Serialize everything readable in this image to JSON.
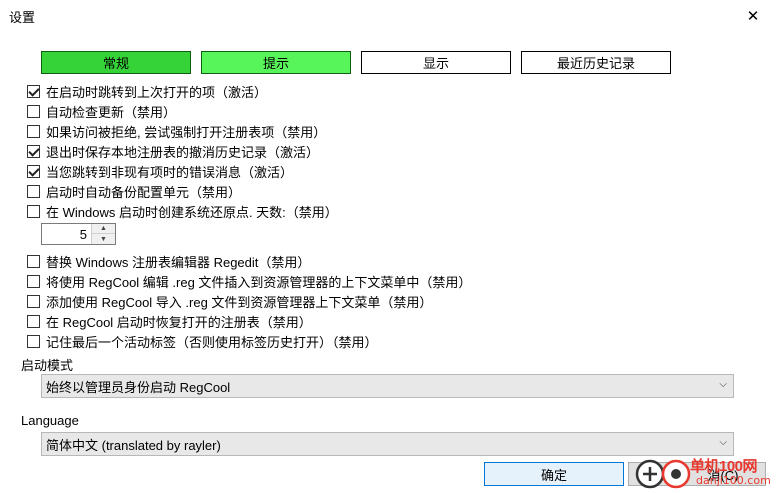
{
  "window": {
    "title": "设置",
    "close_symbol": "✕"
  },
  "tabs": [
    {
      "label": "常规",
      "state": "active"
    },
    {
      "label": "提示",
      "state": "hover"
    },
    {
      "label": "显示",
      "state": "normal"
    },
    {
      "label": "最近历史记录",
      "state": "normal"
    }
  ],
  "options": [
    {
      "label": "在启动时跳转到上次打开的项（激活）",
      "checked": true
    },
    {
      "label": "自动检查更新（禁用）",
      "checked": false
    },
    {
      "label": "如果访问被拒绝, 尝试强制打开注册表项（禁用）",
      "checked": false
    },
    {
      "label": "退出时保存本地注册表的撤消历史记录（激活）",
      "checked": true
    },
    {
      "label": "当您跳转到非现有项时的错误消息（激活）",
      "checked": true
    },
    {
      "label": "启动时自动备份配置单元（禁用）",
      "checked": false
    },
    {
      "label": "在 Windows 启动时创建系统还原点. 天数:（禁用）",
      "checked": false
    }
  ],
  "restore_days": {
    "value": "5",
    "up_symbol": "▲",
    "down_symbol": "▼"
  },
  "options2": [
    {
      "label": "替换 Windows 注册表编辑器 Regedit（禁用）",
      "checked": false
    },
    {
      "label": "将使用 RegCool 编辑 .reg 文件插入到资源管理器的上下文菜单中（禁用）",
      "checked": false
    },
    {
      "label": "添加使用 RegCool 导入 .reg 文件到资源管理器上下文菜单（禁用）",
      "checked": false
    },
    {
      "label": "在 RegCool 启动时恢复打开的注册表（禁用）",
      "checked": false
    },
    {
      "label": "记住最后一个活动标签（否则使用标签历史打开）（禁用）",
      "checked": false
    }
  ],
  "startup_mode": {
    "label": "启动模式",
    "selected": "始终以管理员身份启动 RegCool",
    "arrow_symbol": "⌵"
  },
  "language": {
    "label": "Language",
    "selected": "简体中文  (translated by rayler)",
    "arrow_symbol": "⌵"
  },
  "buttons": {
    "ok": "确定",
    "cancel_partial": "消(C)"
  },
  "watermark": {
    "line1": "单机100网",
    "line2": "danji100.com"
  }
}
